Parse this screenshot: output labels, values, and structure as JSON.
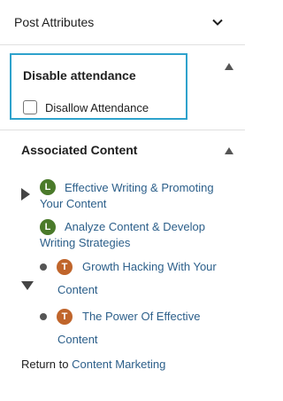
{
  "post_attributes": {
    "title": "Post Attributes",
    "toggle_icon": "chevron-down-icon"
  },
  "disable_attendance": {
    "title": "Disable attendance",
    "checkbox_label": "Disallow Attendance",
    "checked": false,
    "focus_color": "#2ea2cc"
  },
  "associated_content": {
    "title": "Associated Content",
    "items": [
      {
        "badge": "L",
        "line1": "Effective Writing & Promoting",
        "line2": "Your Content"
      },
      {
        "badge": "L",
        "line1": "Analyze Content & Develop",
        "line2": "Writing Strategies"
      },
      {
        "badge": "T",
        "line1": "Growth Hacking With Your",
        "line2": "Content"
      },
      {
        "badge": "T",
        "line1": "The Power Of Effective",
        "line2": "Content"
      }
    ],
    "return_prefix": "Return to",
    "return_link": "Content Marketing"
  },
  "colors": {
    "lesson_badge": "#4a7a2a",
    "topic_badge": "#c0652b",
    "link": "#2c5f8a"
  }
}
